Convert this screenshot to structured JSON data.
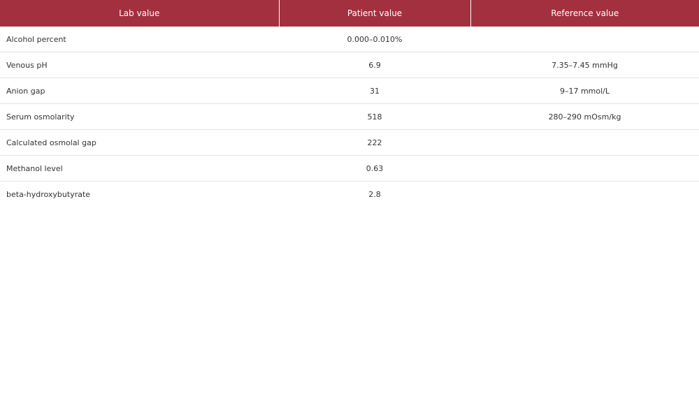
{
  "table": {
    "headers": [
      "Lab value",
      "Patient value",
      "Reference value"
    ],
    "rows": [
      {
        "lab": "Alcohol percent",
        "patient": "0.000–0.010%",
        "reference": ""
      },
      {
        "lab": "Venous pH",
        "patient": "6.9",
        "reference": "7.35–7.45 mmHg"
      },
      {
        "lab": "Anion gap",
        "patient": "31",
        "reference": "9–17 mmol/L"
      },
      {
        "lab": "Serum osmolarity",
        "patient": "518",
        "reference": "280–290 mOsm/kg"
      },
      {
        "lab": "Calculated osmolal gap",
        "patient": "222",
        "reference": ""
      },
      {
        "lab": "Methanol level",
        "patient": "0.63",
        "reference": ""
      },
      {
        "lab": "beta-hydroxybutyrate",
        "patient": "2.8",
        "reference": ""
      }
    ]
  },
  "colors": {
    "header_background": "#a3303e",
    "header_text": "#ffffff",
    "row_divider": "#e3e3e3"
  }
}
